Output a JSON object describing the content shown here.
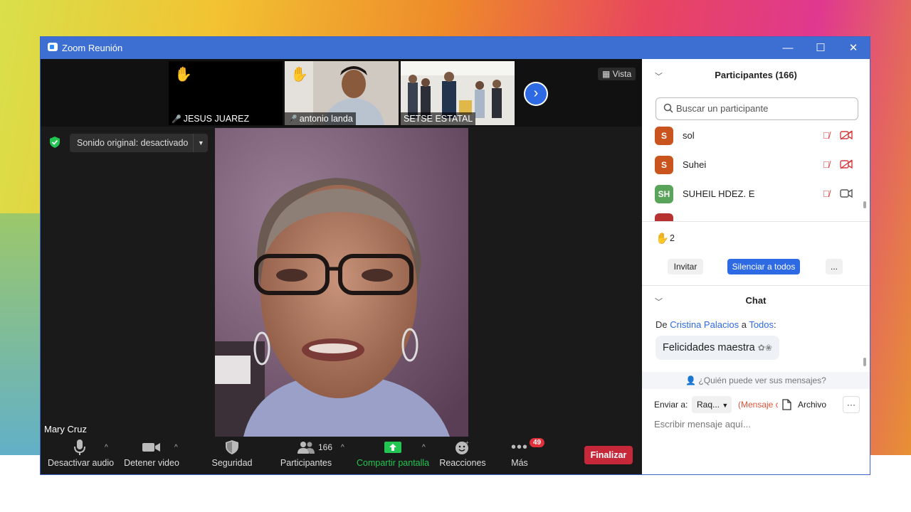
{
  "window": {
    "title": "Zoom Reunión",
    "controls": [
      "minimize",
      "maximize",
      "close"
    ]
  },
  "thumbnails": [
    {
      "name": "JESUS JUAREZ",
      "hand_raised": true,
      "muted": true
    },
    {
      "name": "antonio landa",
      "hand_raised": true,
      "muted": true
    },
    {
      "name": "SETSE ESTATAL",
      "hand_raised": false,
      "muted": false
    }
  ],
  "view_button": "Vista",
  "original_sound": "Sonido original: desactivado",
  "speaker": {
    "name": "Mary Cruz"
  },
  "toolbar": {
    "audio_label": "Desactivar audio",
    "video_label": "Detener video",
    "security_label": "Seguridad",
    "participants_label": "Participantes",
    "participants_count": "166",
    "share_label": "Compartir pantalla",
    "reactions_label": "Reacciones",
    "more_label": "Más",
    "more_badge": "49",
    "end_label": "Finalizar"
  },
  "participants_panel": {
    "title": "Participantes (166)",
    "search_placeholder": "Buscar un participante",
    "list": [
      {
        "initials": "S",
        "name": "sol",
        "color": "#c9541d",
        "video_off": true
      },
      {
        "initials": "S",
        "name": "Suhei",
        "color": "#c9541d",
        "video_off": true
      },
      {
        "initials": "SH",
        "name": "SUHEIL HDEZ. E",
        "color": "#5aa35a",
        "video_off": false
      }
    ],
    "hands_count": "2",
    "invite_label": "Invitar",
    "mute_all_label": "Silenciar a todos",
    "more_label": "..."
  },
  "chat": {
    "title": "Chat",
    "from_prefix": "De",
    "from_name": "Cristina Palacios",
    "to_word": "a",
    "to_name": "Todos",
    "message": "Felicidades maestra",
    "who_can_see": "¿Quién puede ver sus mensajes?",
    "send_to_label": "Enviar a:",
    "recipient": "Raq...",
    "private_note": "(Mensaje c",
    "file_label": "Archivo",
    "more_label": "···",
    "input_placeholder": "Escribir mensaje aquí..."
  },
  "colors": {
    "titlebar": "#3d6fd2",
    "accent": "#2d6ae3",
    "end_button": "#c6283a",
    "share_green": "#23c552"
  }
}
